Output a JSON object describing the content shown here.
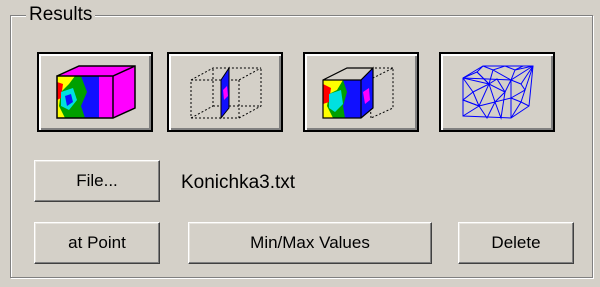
{
  "group": {
    "title": "Results"
  },
  "view_buttons": [
    {
      "icon": "solid-contour-cube-icon"
    },
    {
      "icon": "section-plane-wireframe-icon"
    },
    {
      "icon": "contour-section-cube-icon"
    },
    {
      "icon": "mesh-cube-icon"
    }
  ],
  "file": {
    "button_label": "File...",
    "filename": "Konichka3.txt"
  },
  "actions": {
    "at_point_label": "at Point",
    "minmax_label": "Min/Max Values",
    "delete_label": "Delete"
  },
  "colors": {
    "face": "#d4d0c8",
    "contour_blue": "#1010ff",
    "contour_magenta": "#ff00ff",
    "contour_yellow": "#ffff00",
    "contour_red": "#ff0000",
    "contour_green": "#00a000",
    "contour_cyan": "#00e0e0",
    "mesh_blue": "#0000ff"
  }
}
